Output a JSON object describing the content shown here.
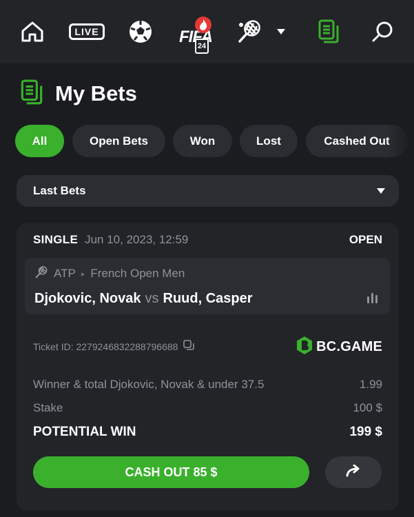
{
  "nav": {
    "items": [
      {
        "name": "home-icon"
      },
      {
        "name": "live-icon",
        "label": "LIVE"
      },
      {
        "name": "soccer-ball-icon"
      },
      {
        "name": "fifa-icon",
        "label": "FIFA",
        "badge": "24"
      },
      {
        "name": "tennis-icon"
      },
      {
        "name": "chevron-down-icon"
      },
      {
        "name": "my-bets-icon"
      },
      {
        "name": "search-icon"
      }
    ]
  },
  "header": {
    "title": "My Bets",
    "icon": "bets-document-icon"
  },
  "tabs": [
    {
      "label": "All",
      "active": true
    },
    {
      "label": "Open Bets",
      "active": false
    },
    {
      "label": "Won",
      "active": false
    },
    {
      "label": "Lost",
      "active": false
    },
    {
      "label": "Cashed Out",
      "active": false
    }
  ],
  "filter": {
    "selected": "Last Bets"
  },
  "bet": {
    "type": "SINGLE",
    "date": "Jun 10, 2023, 12:59",
    "status": "OPEN",
    "event": {
      "sport": "ATP",
      "tournament": "French Open Men",
      "home": "Djokovic, Novak",
      "vs": "vs",
      "away": "Ruud, Casper"
    },
    "ticket": "Ticket ID: 2279246832288796688",
    "brand": "BC.GAME",
    "selection": {
      "label": "Winner & total Djokovic, Novak & under 37.5",
      "odds": "1.99"
    },
    "stake": {
      "label": "Stake",
      "value": "100 $"
    },
    "potential_win": {
      "label": "POTENTIAL WIN",
      "value": "199 $"
    },
    "cashout_label": "CASH OUT 85 $"
  },
  "colors": {
    "accent": "#3ab02d",
    "background": "#1a1c1f",
    "card": "#222427",
    "muted": "#8e939a"
  }
}
